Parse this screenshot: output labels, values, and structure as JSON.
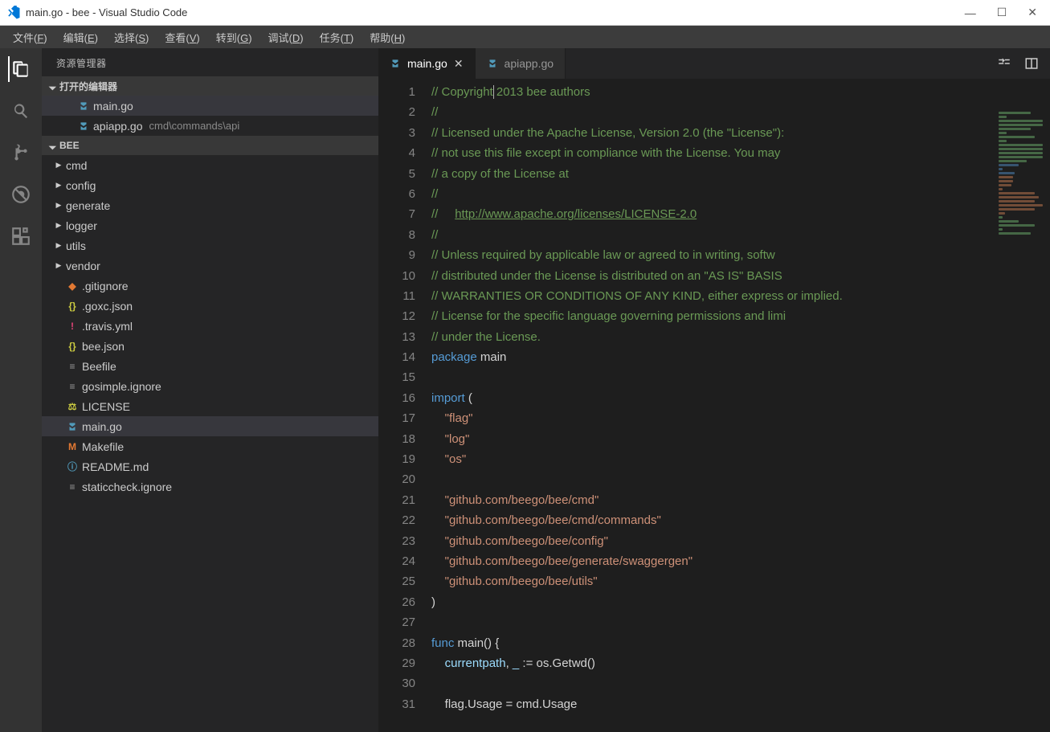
{
  "window": {
    "title": "main.go - bee - Visual Studio Code"
  },
  "menu": [
    {
      "label": "文件",
      "key": "F"
    },
    {
      "label": "编辑",
      "key": "E"
    },
    {
      "label": "选择",
      "key": "S"
    },
    {
      "label": "查看",
      "key": "V"
    },
    {
      "label": "转到",
      "key": "G"
    },
    {
      "label": "调试",
      "key": "D"
    },
    {
      "label": "任务",
      "key": "T"
    },
    {
      "label": "帮助",
      "key": "H"
    }
  ],
  "activity": {
    "explorer": "资源管理器"
  },
  "sidebar": {
    "title": "资源管理器",
    "open_editors_label": "打开的编辑器",
    "open_editors": [
      {
        "name": "main.go",
        "icon": "go",
        "selected": true
      },
      {
        "name": "apiapp.go",
        "icon": "go",
        "hint": "cmd\\commands\\api"
      }
    ],
    "project_name": "BEE",
    "tree": [
      {
        "type": "dir",
        "name": "cmd"
      },
      {
        "type": "dir",
        "name": "config"
      },
      {
        "type": "dir",
        "name": "generate"
      },
      {
        "type": "dir",
        "name": "logger"
      },
      {
        "type": "dir",
        "name": "utils"
      },
      {
        "type": "dir",
        "name": "vendor"
      },
      {
        "type": "file",
        "name": ".gitignore",
        "icon": "git"
      },
      {
        "type": "file",
        "name": ".goxc.json",
        "icon": "json"
      },
      {
        "type": "file",
        "name": ".travis.yml",
        "icon": "yml"
      },
      {
        "type": "file",
        "name": "bee.json",
        "icon": "json"
      },
      {
        "type": "file",
        "name": "Beefile",
        "icon": "txt"
      },
      {
        "type": "file",
        "name": "gosimple.ignore",
        "icon": "txt"
      },
      {
        "type": "file",
        "name": "LICENSE",
        "icon": "lic"
      },
      {
        "type": "file",
        "name": "main.go",
        "icon": "go",
        "selected": true
      },
      {
        "type": "file",
        "name": "Makefile",
        "icon": "make"
      },
      {
        "type": "file",
        "name": "README.md",
        "icon": "info"
      },
      {
        "type": "file",
        "name": "staticcheck.ignore",
        "icon": "txt"
      }
    ]
  },
  "tabs": [
    {
      "name": "main.go",
      "icon": "go",
      "active": true,
      "close": true
    },
    {
      "name": "apiapp.go",
      "icon": "go",
      "active": false
    }
  ],
  "code": {
    "lines": [
      {
        "n": 1,
        "seg": [
          {
            "t": "// Copyright",
            "c": "comment",
            "cursor": true
          },
          {
            "t": " 2013 bee authors",
            "c": "comment"
          }
        ]
      },
      {
        "n": 2,
        "seg": [
          {
            "t": "//",
            "c": "comment"
          }
        ]
      },
      {
        "n": 3,
        "seg": [
          {
            "t": "// Licensed under the Apache License, Version 2.0 (the \"License\"):",
            "c": "comment"
          }
        ]
      },
      {
        "n": 4,
        "seg": [
          {
            "t": "// not use this file except in compliance with the License. You may",
            "c": "comment"
          }
        ]
      },
      {
        "n": 5,
        "seg": [
          {
            "t": "// a copy of the License at",
            "c": "comment"
          }
        ]
      },
      {
        "n": 6,
        "seg": [
          {
            "t": "//",
            "c": "comment"
          }
        ]
      },
      {
        "n": 7,
        "seg": [
          {
            "t": "//     ",
            "c": "comment"
          },
          {
            "t": "http://www.apache.org/licenses/LICENSE-2.0",
            "c": "link"
          }
        ]
      },
      {
        "n": 8,
        "seg": [
          {
            "t": "//",
            "c": "comment"
          }
        ]
      },
      {
        "n": 9,
        "seg": [
          {
            "t": "// Unless required by applicable law or agreed to in writing, softw",
            "c": "comment"
          }
        ]
      },
      {
        "n": 10,
        "seg": [
          {
            "t": "// distributed under the License is distributed on an \"AS IS\" BASIS",
            "c": "comment"
          }
        ]
      },
      {
        "n": 11,
        "seg": [
          {
            "t": "// WARRANTIES OR CONDITIONS OF ANY KIND, either express or implied.",
            "c": "comment"
          }
        ]
      },
      {
        "n": 12,
        "seg": [
          {
            "t": "// License for the specific language governing permissions and limi",
            "c": "comment"
          }
        ]
      },
      {
        "n": 13,
        "seg": [
          {
            "t": "// under the License.",
            "c": "comment"
          }
        ]
      },
      {
        "n": 14,
        "seg": [
          {
            "t": "package",
            "c": "key"
          },
          {
            "t": " main",
            "c": "op"
          }
        ]
      },
      {
        "n": 15,
        "seg": []
      },
      {
        "n": 16,
        "seg": [
          {
            "t": "import",
            "c": "key"
          },
          {
            "t": " (",
            "c": "op"
          }
        ]
      },
      {
        "n": 17,
        "seg": [
          {
            "t": "    ",
            "c": "op"
          },
          {
            "t": "\"flag\"",
            "c": "str"
          }
        ]
      },
      {
        "n": 18,
        "seg": [
          {
            "t": "    ",
            "c": "op"
          },
          {
            "t": "\"log\"",
            "c": "str"
          }
        ]
      },
      {
        "n": 19,
        "seg": [
          {
            "t": "    ",
            "c": "op"
          },
          {
            "t": "\"os\"",
            "c": "str"
          }
        ]
      },
      {
        "n": 20,
        "seg": []
      },
      {
        "n": 21,
        "seg": [
          {
            "t": "    ",
            "c": "op"
          },
          {
            "t": "\"github.com/beego/bee/cmd\"",
            "c": "str"
          }
        ]
      },
      {
        "n": 22,
        "seg": [
          {
            "t": "    ",
            "c": "op"
          },
          {
            "t": "\"github.com/beego/bee/cmd/commands\"",
            "c": "str"
          }
        ]
      },
      {
        "n": 23,
        "seg": [
          {
            "t": "    ",
            "c": "op"
          },
          {
            "t": "\"github.com/beego/bee/config\"",
            "c": "str"
          }
        ]
      },
      {
        "n": 24,
        "seg": [
          {
            "t": "    ",
            "c": "op"
          },
          {
            "t": "\"github.com/beego/bee/generate/swaggergen\"",
            "c": "str"
          }
        ]
      },
      {
        "n": 25,
        "seg": [
          {
            "t": "    ",
            "c": "op"
          },
          {
            "t": "\"github.com/beego/bee/utils\"",
            "c": "str"
          }
        ]
      },
      {
        "n": 26,
        "seg": [
          {
            "t": ")",
            "c": "op"
          }
        ]
      },
      {
        "n": 27,
        "seg": []
      },
      {
        "n": 28,
        "seg": [
          {
            "t": "func",
            "c": "key"
          },
          {
            "t": " main() {",
            "c": "op"
          }
        ]
      },
      {
        "n": 29,
        "seg": [
          {
            "t": "    currentpath",
            "c": "ident"
          },
          {
            "t": ", ",
            "c": "op"
          },
          {
            "t": "_",
            "c": "ident"
          },
          {
            "t": " := os.Getwd()",
            "c": "op"
          }
        ]
      },
      {
        "n": 30,
        "seg": []
      },
      {
        "n": 31,
        "seg": [
          {
            "t": "    flag.Usage = cmd.Usage",
            "c": "op"
          }
        ]
      }
    ]
  }
}
